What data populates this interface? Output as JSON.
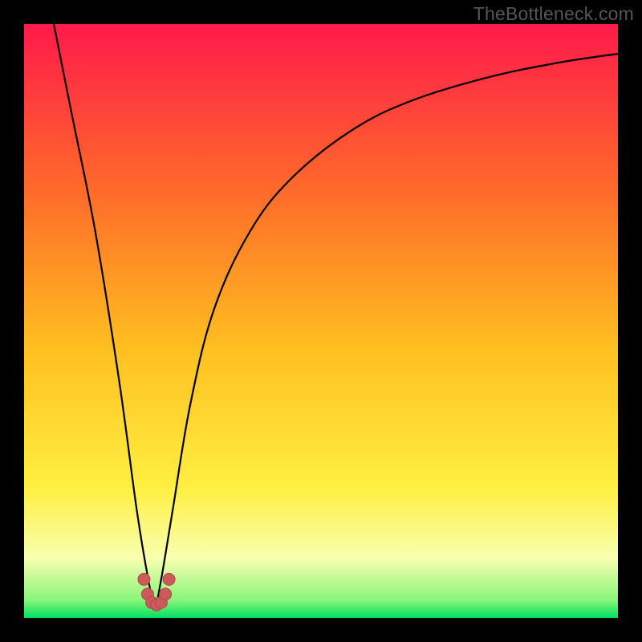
{
  "watermark": "TheBottleneck.com",
  "colors": {
    "frame": "#000000",
    "gradient_top": "#ff1a4b",
    "gradient_mid1": "#ff6a2a",
    "gradient_mid2": "#ffc020",
    "gradient_mid3": "#ffef40",
    "gradient_band": "#f8ffb0",
    "gradient_bottom": "#00e060",
    "curve": "#000000",
    "marker_fill": "#cc5a5a",
    "marker_stroke": "#b04848"
  },
  "chart_data": {
    "type": "line",
    "title": "",
    "xlabel": "",
    "ylabel": "",
    "xlim": [
      0,
      100
    ],
    "ylim": [
      0,
      100
    ],
    "note": "Axes are unlabeled; values are normalized 0–100 estimates of pixel positions. The curve drops from top-left to a sharp minimum near x≈22 then rises asymptotically toward the right edge.",
    "series": [
      {
        "name": "curve",
        "x": [
          5,
          8,
          12,
          16,
          19,
          21,
          22,
          23,
          25,
          28,
          32,
          38,
          45,
          55,
          65,
          78,
          90,
          100
        ],
        "y": [
          100,
          85,
          65,
          40,
          18,
          6,
          2,
          6,
          18,
          36,
          52,
          65,
          74,
          82,
          87,
          91,
          93.5,
          95
        ]
      }
    ],
    "markers": {
      "name": "highlight-points",
      "note": "Small salmon dotted U at the curve minimum.",
      "x": [
        20.2,
        20.8,
        21.5,
        22.3,
        23.1,
        23.8,
        24.4
      ],
      "y": [
        6.5,
        4.0,
        2.6,
        2.2,
        2.6,
        4.0,
        6.5
      ]
    }
  }
}
